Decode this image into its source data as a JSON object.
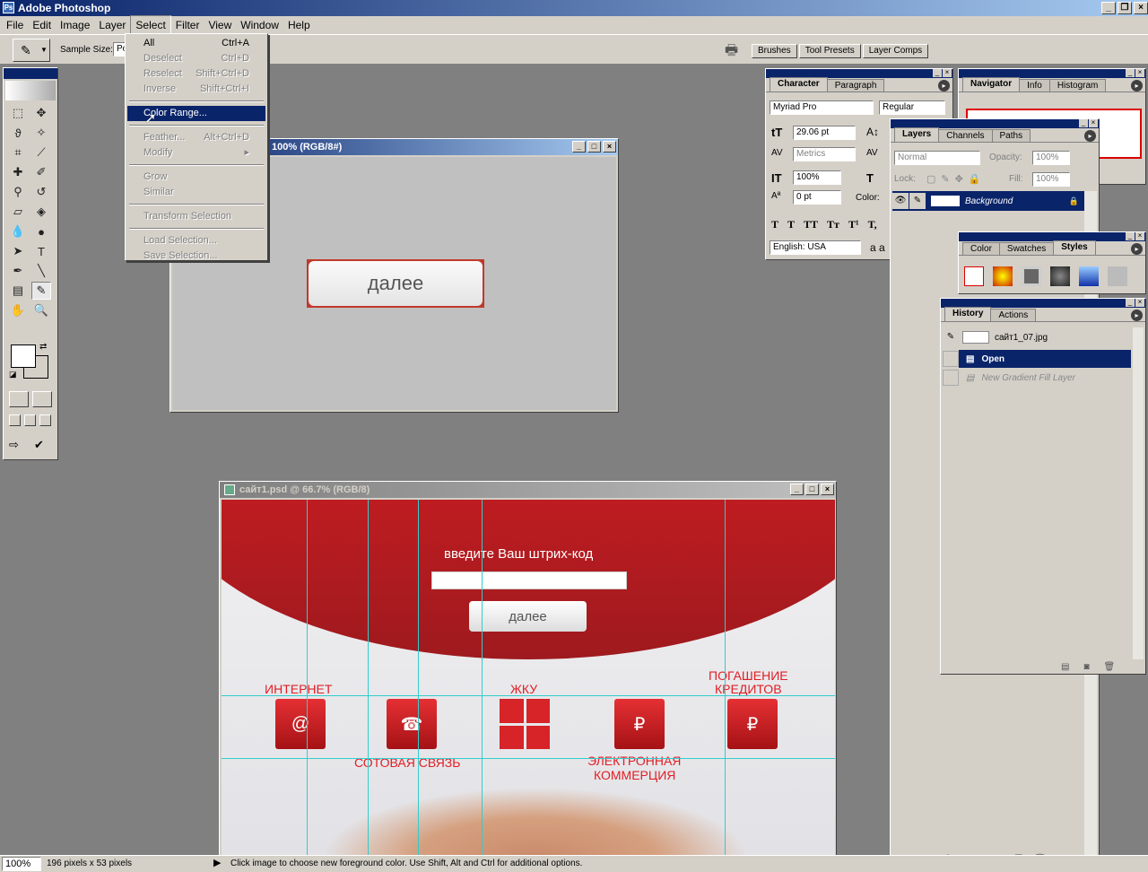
{
  "app": {
    "title": "Adobe Photoshop"
  },
  "menu": [
    "File",
    "Edit",
    "Image",
    "Layer",
    "Select",
    "Filter",
    "View",
    "Window",
    "Help"
  ],
  "options": {
    "sample_size_label": "Sample Size:",
    "sample_size_value": "Po"
  },
  "palette_well": [
    "Brushes",
    "Tool Presets",
    "Layer Comps"
  ],
  "select_menu": [
    {
      "label": "All",
      "shortcut": "Ctrl+A",
      "enabled": true
    },
    {
      "label": "Deselect",
      "shortcut": "Ctrl+D",
      "enabled": false
    },
    {
      "label": "Reselect",
      "shortcut": "Shift+Ctrl+D",
      "enabled": false
    },
    {
      "label": "Inverse",
      "shortcut": "Shift+Ctrl+I",
      "enabled": false
    },
    {
      "label": "Color Range...",
      "shortcut": "",
      "enabled": true
    },
    {
      "label": "Feather...",
      "shortcut": "Alt+Ctrl+D",
      "enabled": false
    },
    {
      "label": "Modify",
      "shortcut": "",
      "enabled": false
    },
    {
      "label": "Grow",
      "shortcut": "",
      "enabled": false
    },
    {
      "label": "Similar",
      "shortcut": "",
      "enabled": false
    },
    {
      "label": "Transform Selection",
      "shortcut": "",
      "enabled": false
    },
    {
      "label": "Load Selection...",
      "shortcut": "",
      "enabled": false
    },
    {
      "label": "Save Selection...",
      "shortcut": "",
      "enabled": false
    }
  ],
  "doc1": {
    "title": "100% (RGB/8#)",
    "button_text": "далее"
  },
  "doc2": {
    "title": "сайт1.psd @ 66.7% (RGB/8)",
    "prompt": "введите Ваш штрих-код",
    "button": "далее",
    "services": {
      "internet": "ИНТЕРНЕТ",
      "mobile": "СОТОВАЯ СВЯЗЬ",
      "zhku": "ЖКУ",
      "ecommerce1": "ЭЛЕКТРОННАЯ",
      "ecommerce2": "КОММЕРЦИЯ",
      "credit1": "ПОГАШЕНИЕ",
      "credit2": "КРЕДИТОВ"
    }
  },
  "character": {
    "tabs": [
      "Character",
      "Paragraph"
    ],
    "font": "Myriad Pro",
    "style": "Regular",
    "size": "29.06 pt",
    "leading": "",
    "kerning": "Metrics",
    "tracking": "",
    "vscale": "100%",
    "hscale": "",
    "baseline": "0 pt",
    "color_label": "Color:",
    "lang": "English: USA",
    "aa": "a a",
    "style_btns": [
      "T",
      "T",
      "TT",
      "Tт",
      "T¹",
      "T,"
    ]
  },
  "navigator": {
    "tabs": [
      "Navigator",
      "Info",
      "Histogram"
    ]
  },
  "layers": {
    "tabs": [
      "Layers",
      "Channels",
      "Paths"
    ],
    "blend": "Normal",
    "opacity_label": "Opacity:",
    "opacity": "100%",
    "lock_label": "Lock:",
    "fill_label": "Fill:",
    "fill": "100%",
    "layer_name": "Background"
  },
  "color_pal": {
    "tabs": [
      "Color",
      "Swatches",
      "Styles"
    ]
  },
  "history": {
    "tabs": [
      "History",
      "Actions"
    ],
    "snapshot": "сайт1_07.jpg",
    "items": [
      "Open",
      "New Gradient Fill Layer"
    ]
  },
  "status": {
    "zoom": "100%",
    "info": "196 pixels x 53 pixels",
    "hint": "Click image to choose new foreground color.  Use Shift, Alt and Ctrl for additional options."
  }
}
